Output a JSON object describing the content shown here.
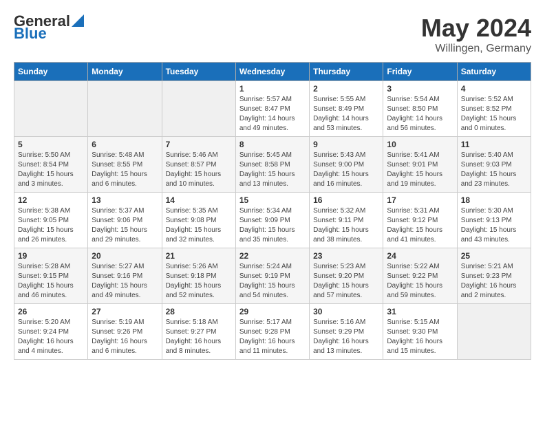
{
  "logo": {
    "line1": "General",
    "line2": "Blue"
  },
  "title": "May 2024",
  "location": "Willingen, Germany",
  "headers": [
    "Sunday",
    "Monday",
    "Tuesday",
    "Wednesday",
    "Thursday",
    "Friday",
    "Saturday"
  ],
  "weeks": [
    [
      {
        "day": "",
        "info": ""
      },
      {
        "day": "",
        "info": ""
      },
      {
        "day": "",
        "info": ""
      },
      {
        "day": "1",
        "info": "Sunrise: 5:57 AM\nSunset: 8:47 PM\nDaylight: 14 hours\nand 49 minutes."
      },
      {
        "day": "2",
        "info": "Sunrise: 5:55 AM\nSunset: 8:49 PM\nDaylight: 14 hours\nand 53 minutes."
      },
      {
        "day": "3",
        "info": "Sunrise: 5:54 AM\nSunset: 8:50 PM\nDaylight: 14 hours\nand 56 minutes."
      },
      {
        "day": "4",
        "info": "Sunrise: 5:52 AM\nSunset: 8:52 PM\nDaylight: 15 hours\nand 0 minutes."
      }
    ],
    [
      {
        "day": "5",
        "info": "Sunrise: 5:50 AM\nSunset: 8:54 PM\nDaylight: 15 hours\nand 3 minutes."
      },
      {
        "day": "6",
        "info": "Sunrise: 5:48 AM\nSunset: 8:55 PM\nDaylight: 15 hours\nand 6 minutes."
      },
      {
        "day": "7",
        "info": "Sunrise: 5:46 AM\nSunset: 8:57 PM\nDaylight: 15 hours\nand 10 minutes."
      },
      {
        "day": "8",
        "info": "Sunrise: 5:45 AM\nSunset: 8:58 PM\nDaylight: 15 hours\nand 13 minutes."
      },
      {
        "day": "9",
        "info": "Sunrise: 5:43 AM\nSunset: 9:00 PM\nDaylight: 15 hours\nand 16 minutes."
      },
      {
        "day": "10",
        "info": "Sunrise: 5:41 AM\nSunset: 9:01 PM\nDaylight: 15 hours\nand 19 minutes."
      },
      {
        "day": "11",
        "info": "Sunrise: 5:40 AM\nSunset: 9:03 PM\nDaylight: 15 hours\nand 23 minutes."
      }
    ],
    [
      {
        "day": "12",
        "info": "Sunrise: 5:38 AM\nSunset: 9:05 PM\nDaylight: 15 hours\nand 26 minutes."
      },
      {
        "day": "13",
        "info": "Sunrise: 5:37 AM\nSunset: 9:06 PM\nDaylight: 15 hours\nand 29 minutes."
      },
      {
        "day": "14",
        "info": "Sunrise: 5:35 AM\nSunset: 9:08 PM\nDaylight: 15 hours\nand 32 minutes."
      },
      {
        "day": "15",
        "info": "Sunrise: 5:34 AM\nSunset: 9:09 PM\nDaylight: 15 hours\nand 35 minutes."
      },
      {
        "day": "16",
        "info": "Sunrise: 5:32 AM\nSunset: 9:11 PM\nDaylight: 15 hours\nand 38 minutes."
      },
      {
        "day": "17",
        "info": "Sunrise: 5:31 AM\nSunset: 9:12 PM\nDaylight: 15 hours\nand 41 minutes."
      },
      {
        "day": "18",
        "info": "Sunrise: 5:30 AM\nSunset: 9:13 PM\nDaylight: 15 hours\nand 43 minutes."
      }
    ],
    [
      {
        "day": "19",
        "info": "Sunrise: 5:28 AM\nSunset: 9:15 PM\nDaylight: 15 hours\nand 46 minutes."
      },
      {
        "day": "20",
        "info": "Sunrise: 5:27 AM\nSunset: 9:16 PM\nDaylight: 15 hours\nand 49 minutes."
      },
      {
        "day": "21",
        "info": "Sunrise: 5:26 AM\nSunset: 9:18 PM\nDaylight: 15 hours\nand 52 minutes."
      },
      {
        "day": "22",
        "info": "Sunrise: 5:24 AM\nSunset: 9:19 PM\nDaylight: 15 hours\nand 54 minutes."
      },
      {
        "day": "23",
        "info": "Sunrise: 5:23 AM\nSunset: 9:20 PM\nDaylight: 15 hours\nand 57 minutes."
      },
      {
        "day": "24",
        "info": "Sunrise: 5:22 AM\nSunset: 9:22 PM\nDaylight: 15 hours\nand 59 minutes."
      },
      {
        "day": "25",
        "info": "Sunrise: 5:21 AM\nSunset: 9:23 PM\nDaylight: 16 hours\nand 2 minutes."
      }
    ],
    [
      {
        "day": "26",
        "info": "Sunrise: 5:20 AM\nSunset: 9:24 PM\nDaylight: 16 hours\nand 4 minutes."
      },
      {
        "day": "27",
        "info": "Sunrise: 5:19 AM\nSunset: 9:26 PM\nDaylight: 16 hours\nand 6 minutes."
      },
      {
        "day": "28",
        "info": "Sunrise: 5:18 AM\nSunset: 9:27 PM\nDaylight: 16 hours\nand 8 minutes."
      },
      {
        "day": "29",
        "info": "Sunrise: 5:17 AM\nSunset: 9:28 PM\nDaylight: 16 hours\nand 11 minutes."
      },
      {
        "day": "30",
        "info": "Sunrise: 5:16 AM\nSunset: 9:29 PM\nDaylight: 16 hours\nand 13 minutes."
      },
      {
        "day": "31",
        "info": "Sunrise: 5:15 AM\nSunset: 9:30 PM\nDaylight: 16 hours\nand 15 minutes."
      },
      {
        "day": "",
        "info": ""
      }
    ]
  ]
}
